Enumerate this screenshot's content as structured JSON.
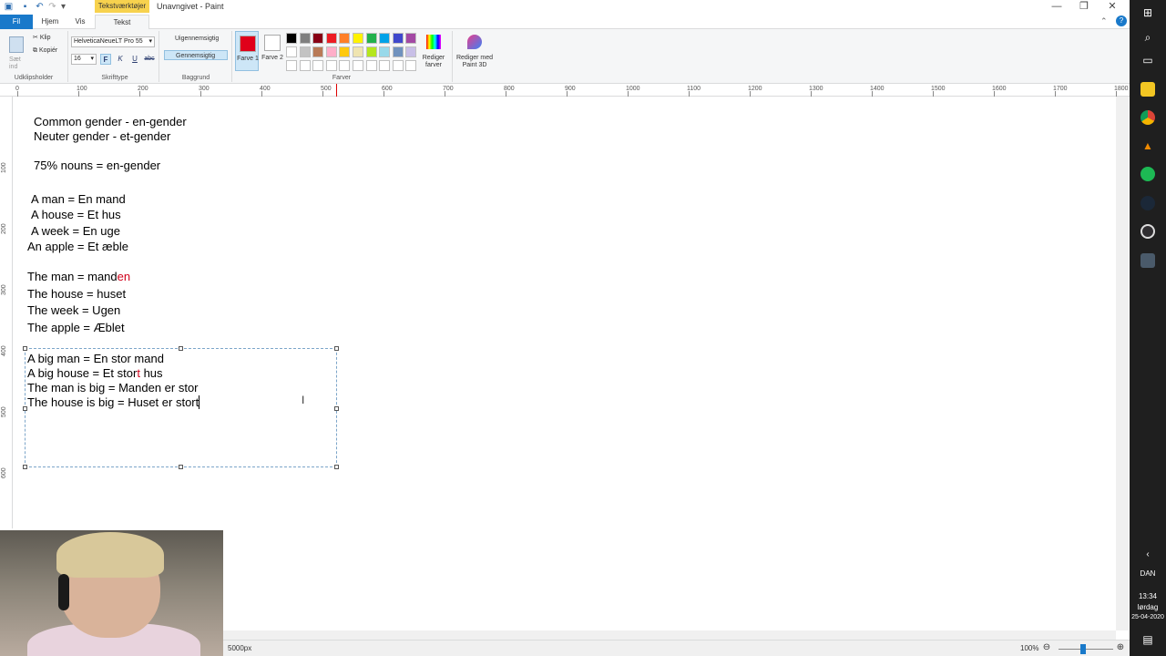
{
  "window": {
    "context_tab": "Tekstværktøjer",
    "title": "Unavngivet - Paint",
    "controls": {
      "minimize": "—",
      "restore": "❐",
      "close": "✕"
    }
  },
  "tabs": {
    "fil": "Fil",
    "hjem": "Hjem",
    "vis": "Vis",
    "tekst": "Tekst"
  },
  "ribbon": {
    "clipboard": {
      "paste": "Sæt ind",
      "cut": "Klip",
      "copy": "Kopiér",
      "group": "Udklipsholder"
    },
    "font": {
      "name": "HelveticaNeueLT Pro 55",
      "size": "16",
      "bold": "F",
      "italic": "K",
      "underline": "U",
      "strike": "abc",
      "group": "Skrifttype"
    },
    "background": {
      "opaque": "Uigennemsigtig",
      "transparent": "Gennemsigtig",
      "group": "Baggrund"
    },
    "colors": {
      "farve1": "Farve 1",
      "farve2": "Farve 2",
      "group": "Farver",
      "color1_value": "#e0001a",
      "color2_value": "#ffffff",
      "edit_colors": "Rediger farver",
      "edit_paint3d": "Rediger med Paint 3D",
      "palette": [
        "#000000",
        "#7f7f7f",
        "#880015",
        "#ed1c24",
        "#ff7f27",
        "#fff200",
        "#22b14c",
        "#00a2e8",
        "#3f48cc",
        "#a349a4",
        "#ffffff",
        "#c3c3c3",
        "#b97a57",
        "#ffaec9",
        "#ffc90e",
        "#efe4b0",
        "#b5e61d",
        "#99d9ea",
        "#7092be",
        "#c8bfe7"
      ]
    }
  },
  "ruler": {
    "ticks": [
      "0",
      "100",
      "200",
      "300",
      "400",
      "500",
      "600",
      "700",
      "800",
      "900",
      "1000",
      "1100",
      "1200",
      "1300",
      "1400",
      "1500",
      "1600",
      "1700",
      "1800"
    ]
  },
  "vruler": {
    "ticks": [
      "100",
      "200",
      "300",
      "400",
      "500",
      "600"
    ]
  },
  "canvas": {
    "line1": "Common gender - en-gender",
    "line2": "Neuter gender - et-gender",
    "line3": "75% nouns = en-gender",
    "line4": "A man = En mand",
    "line5": "A house = Et hus",
    "line6": "A week = En uge",
    "line7": "An apple = Et æble",
    "line8_a": "The man = mand",
    "line8_b": "en",
    "line9": "The house = huset",
    "line10": "The week = Ugen",
    "line11": "The apple = Æblet",
    "box1": "A big man = En stor mand",
    "box2_a": "A big house = Et stor",
    "box2_b": "t",
    "box2_c": " hus",
    "box3": "The man is big = Manden er stor",
    "box4": "The house is big = Huset er stort"
  },
  "status": {
    "canvas_size": "5000px",
    "zoom": "100%",
    "minus": "⊖",
    "plus": "⊕"
  },
  "taskbar": {
    "lang": "DAN",
    "time": "13:34",
    "day": "lørdag",
    "date": "25-04-2020"
  }
}
